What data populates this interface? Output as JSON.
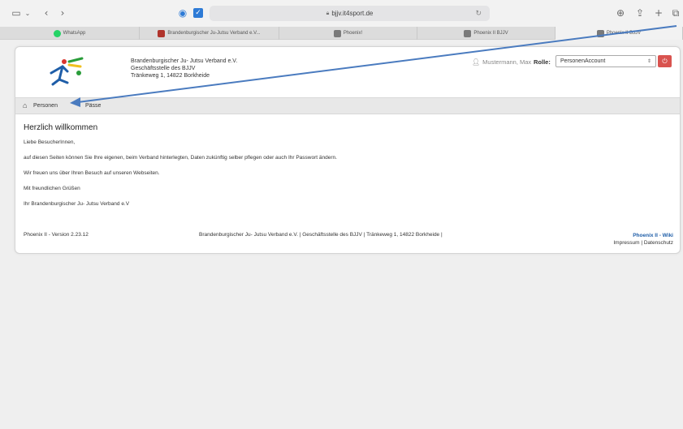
{
  "browser": {
    "url": "bjjv.it4sport.de",
    "tabs": [
      {
        "label": "WhatsApp",
        "color": "#25d366"
      },
      {
        "label": "Brandenburgischer Ju-Jutsu Verband e.V...",
        "color": "#b0342c"
      },
      {
        "label": "Phoenix!",
        "color": "#7a7a7a"
      },
      {
        "label": "Phoenix II BJJV",
        "color": "#7a7a7a"
      },
      {
        "label": "Phoenix II BJJV",
        "color": "#7a7a7a"
      }
    ]
  },
  "header": {
    "org_name": "Brandenburgischer Ju- Jutsu Verband e.V.",
    "org_office": "Geschäftsstelle des BJJV",
    "org_address": "Tränkeweg 1, 14822 Borkheide",
    "user_name": "Mustermann, Max",
    "role_label": "Rolle:",
    "role_value": "PersonenAccount"
  },
  "nav": {
    "item1": "Personen",
    "item2": "Pässe"
  },
  "content": {
    "welcome": "Herzlich willkommen",
    "greeting": "Liebe BesucherInnen,",
    "p1": "auf diesen Seiten können Sie Ihre eigenen, beim Verband hinterlegten, Daten zukünftig selber pflegen oder auch Ihr Passwort ändern.",
    "p2": "Wir freuen uns über Ihren Besuch auf unseren Webseiten.",
    "p3": "Mit freundlichen Grüßen",
    "p4": "Ihr Brandenburgischer Ju- Jutsu Verband e.V"
  },
  "footer": {
    "version": "Phoenix II - Version 2.23.12",
    "center": "Brandenburgischer Ju- Jutsu Verband e.V. | Geschäftsstelle des BJJV | Tränkeweg 1, 14822 Borkheide |",
    "wiki": "Phoenix II - Wiki",
    "impressum": "Impressum",
    "sep": "|",
    "datenschutz": "Datenschutz"
  },
  "colors": {
    "accent": "#1f5ea8",
    "danger": "#d9534f",
    "arrow": "#4a7bbf"
  }
}
